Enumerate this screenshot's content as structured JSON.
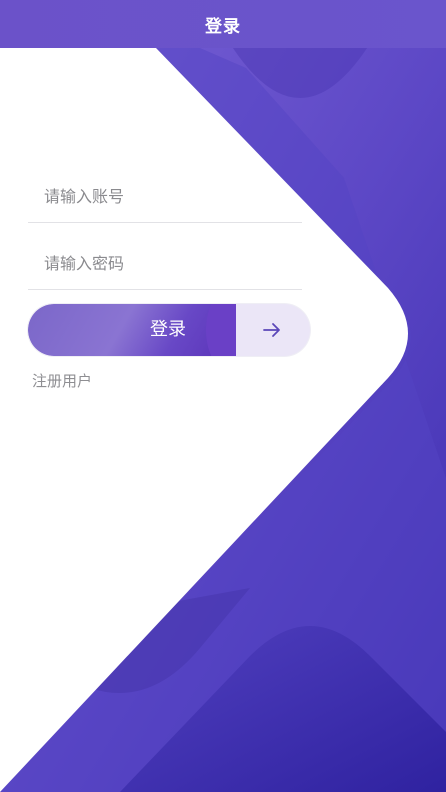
{
  "nav": {
    "title": "登录"
  },
  "form": {
    "account_placeholder": "请输入账号",
    "password_placeholder": "请输入密码",
    "login_label": "登录",
    "register_label": "注册用户"
  },
  "colors": {
    "primary": "#6b52c9",
    "primary_dark": "#3324a0",
    "field_border": "#e2e2e6",
    "placeholder": "#8a8a8e"
  },
  "icons": {
    "submit": "arrow-right-icon"
  }
}
